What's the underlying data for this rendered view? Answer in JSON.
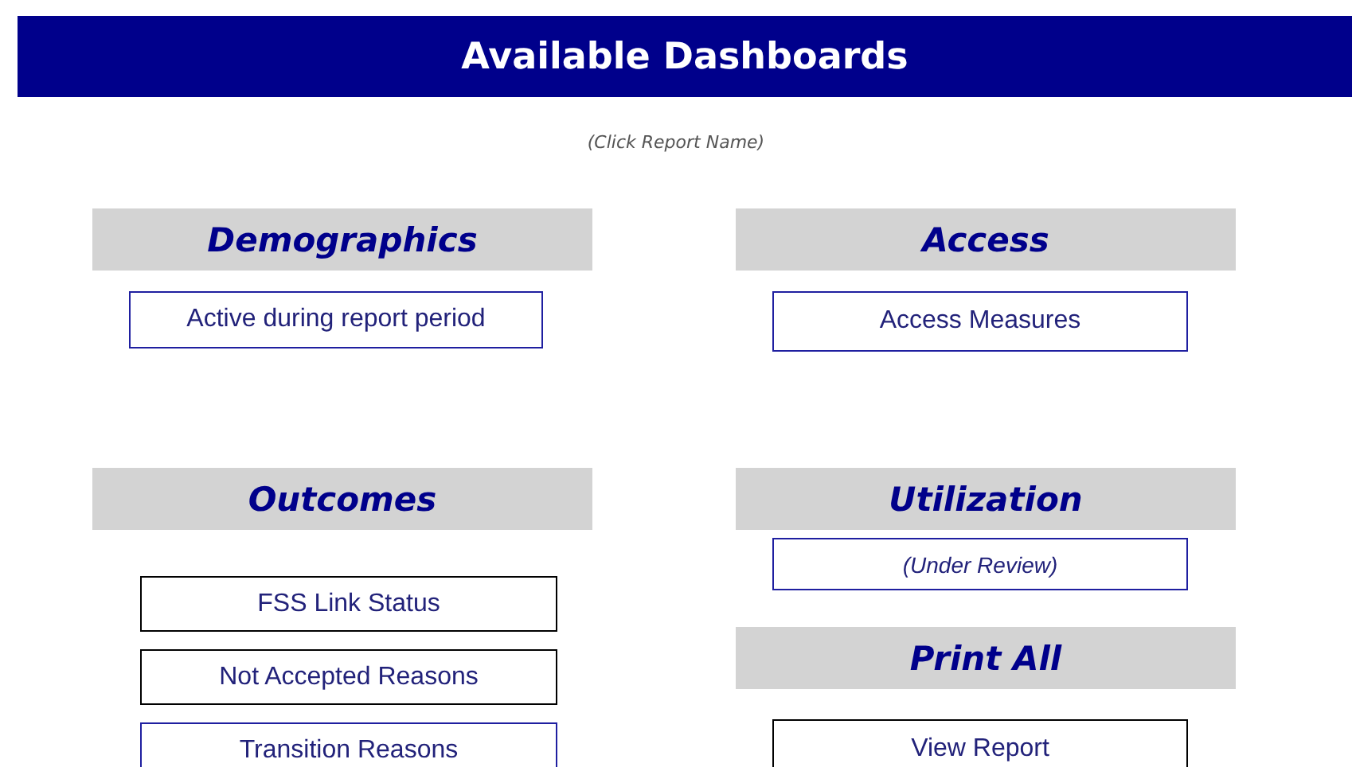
{
  "title": "Available Dashboards",
  "hint": "(Click Report Name)",
  "columns": [
    {
      "sections": [
        {
          "heading": "Demographics",
          "reports": [
            {
              "label": "Active during report period",
              "kind": "link",
              "color": "#1f1fa0"
            }
          ]
        },
        {
          "heading": "Outcomes",
          "reports": [
            {
              "label": "FSS Link Status",
              "kind": "link",
              "color": "#000000"
            },
            {
              "label": "Not Accepted Reasons",
              "kind": "link",
              "color": "#000000"
            },
            {
              "label": "Transition Reasons",
              "kind": "link",
              "color": "#1f1fa0"
            }
          ]
        }
      ]
    },
    {
      "sections": [
        {
          "heading": "Access",
          "reports": [
            {
              "label": "Access Measures",
              "kind": "link",
              "color": "#1f1fa0"
            }
          ]
        },
        {
          "heading": "Utilization",
          "reports": [
            {
              "label": "(Under Review)",
              "kind": "pending",
              "color": "#1f1fa0"
            }
          ]
        },
        {
          "heading": "Print All",
          "reports": [
            {
              "label": "View Report",
              "kind": "link",
              "color": "#000000"
            }
          ]
        }
      ]
    }
  ]
}
